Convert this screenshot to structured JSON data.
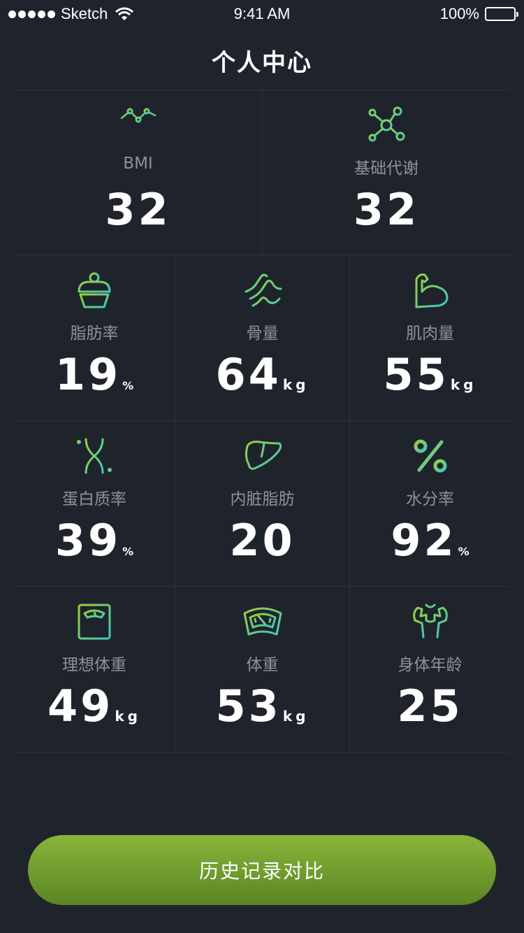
{
  "status_bar": {
    "carrier": "Sketch",
    "time": "9:41 AM",
    "battery": "100%"
  },
  "header": {
    "title": "个人中心"
  },
  "metrics_top": [
    {
      "icon": "chart-bars-icon",
      "label": "BMI",
      "value": "32",
      "unit": ""
    },
    {
      "icon": "molecule-icon",
      "label": "基础代谢",
      "value": "32",
      "unit": ""
    }
  ],
  "metrics": [
    {
      "icon": "cupcake-icon",
      "label": "脂肪率",
      "value": "19",
      "unit": "%"
    },
    {
      "icon": "bone-icon",
      "label": "骨量",
      "value": "64",
      "unit": "kg"
    },
    {
      "icon": "muscle-icon",
      "label": "肌肉量",
      "value": "55",
      "unit": "kg"
    },
    {
      "icon": "dna-icon",
      "label": "蛋白质率",
      "value": "39",
      "unit": "%"
    },
    {
      "icon": "liver-icon",
      "label": "内脏脂肪",
      "value": "20",
      "unit": ""
    },
    {
      "icon": "percent-icon",
      "label": "水分率",
      "value": "92",
      "unit": "%"
    },
    {
      "icon": "scale-icon",
      "label": "理想体重",
      "value": "49",
      "unit": "kg"
    },
    {
      "icon": "weight-gauge-icon",
      "label": "体重",
      "value": "53",
      "unit": "kg"
    },
    {
      "icon": "body-icon",
      "label": "身体年龄",
      "value": "25",
      "unit": ""
    }
  ],
  "button": {
    "label": "历史记录对比"
  },
  "colors": {
    "background": "#1f242c",
    "accent_green": "#8dc63f",
    "accent_teal": "#3fc8c0",
    "button_top": "#89b53a",
    "button_bottom": "#5b8524"
  }
}
